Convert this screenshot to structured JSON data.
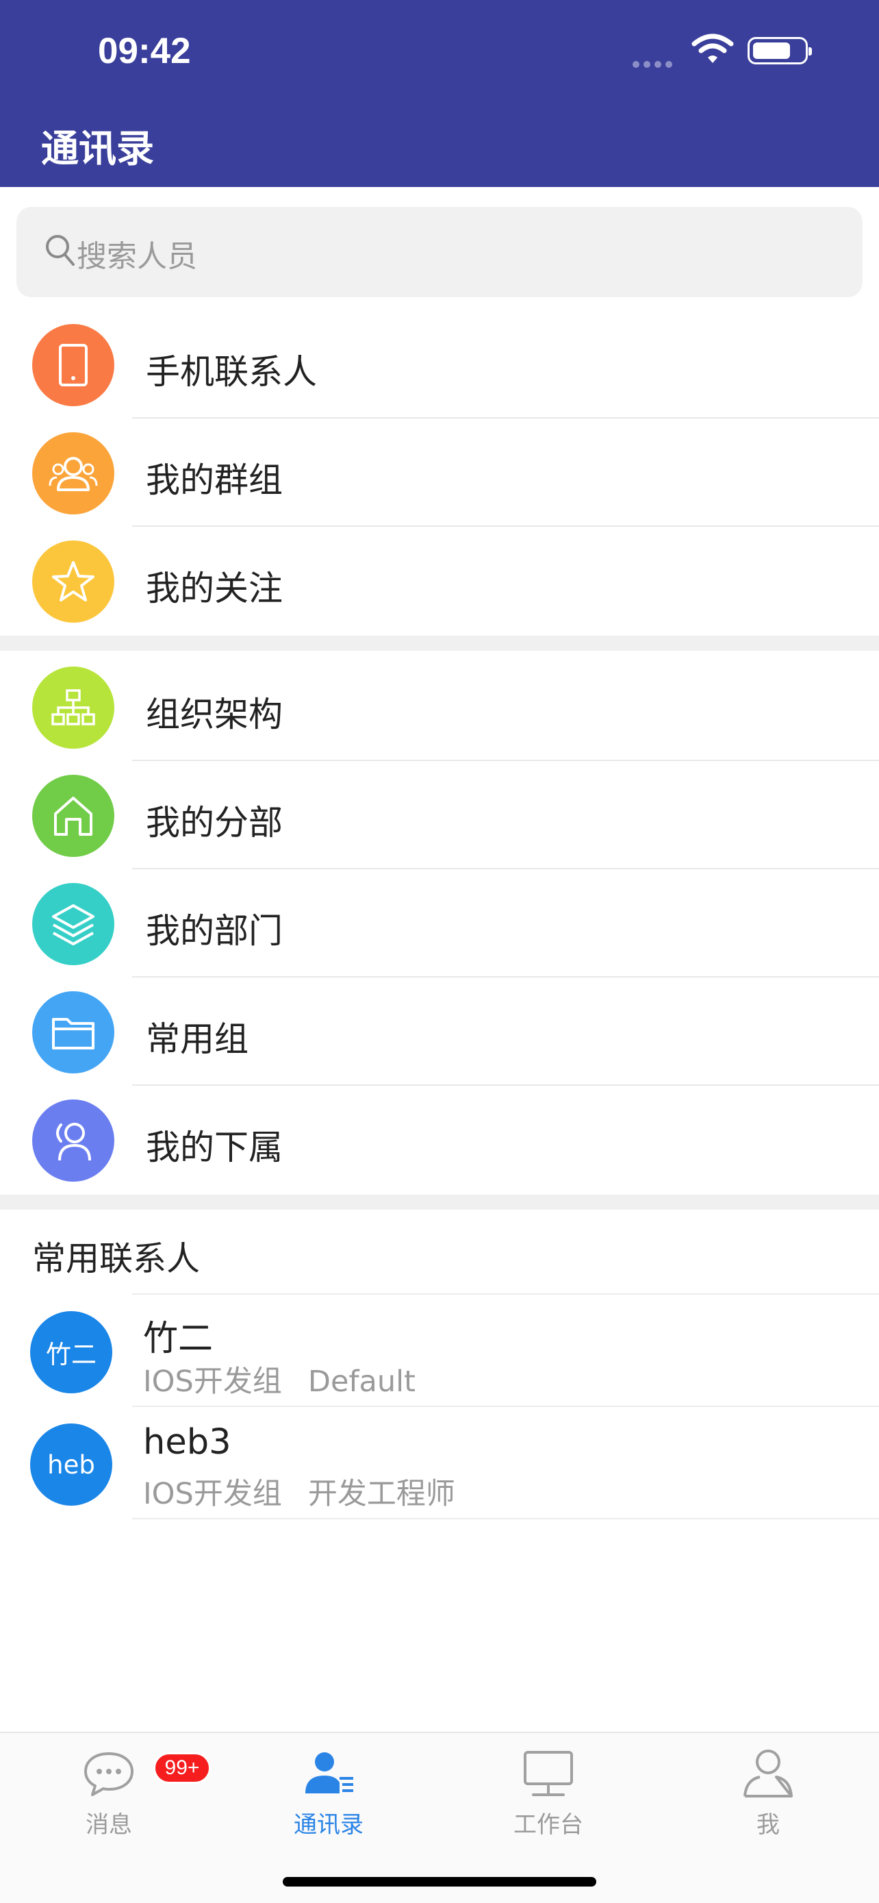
{
  "status": {
    "time": "09:42"
  },
  "header": {
    "title": "通讯录"
  },
  "search": {
    "placeholder": "搜索人员"
  },
  "group1": [
    {
      "label": "手机联系人",
      "icon": "phone-icon",
      "color": "#fa7a45"
    },
    {
      "label": "我的群组",
      "icon": "group-icon",
      "color": "#fba43a"
    },
    {
      "label": "我的关注",
      "icon": "star-icon",
      "color": "#fcc63c"
    }
  ],
  "group2": [
    {
      "label": "组织架构",
      "icon": "org-chart-icon",
      "color": "#b7e43a"
    },
    {
      "label": "我的分部",
      "icon": "home-icon",
      "color": "#71cc48"
    },
    {
      "label": "我的部门",
      "icon": "layers-icon",
      "color": "#35cfc7"
    },
    {
      "label": "常用组",
      "icon": "folder-icon",
      "color": "#44a5f5"
    },
    {
      "label": "我的下属",
      "icon": "subordinate-icon",
      "color": "#6a7ef0"
    }
  ],
  "frequent": {
    "title": "常用联系人",
    "contacts": [
      {
        "avatar": "竹二",
        "name": "竹二",
        "dept": "IOS开发组",
        "role": "Default"
      },
      {
        "avatar": "heb",
        "name": "heb3",
        "dept": "IOS开发组",
        "role": "开发工程师"
      }
    ]
  },
  "tabbar": {
    "tabs": [
      {
        "label": "消息",
        "badge": "99+"
      },
      {
        "label": "通讯录"
      },
      {
        "label": "工作台"
      },
      {
        "label": "我"
      }
    ],
    "active_color": "#2a84e6"
  }
}
